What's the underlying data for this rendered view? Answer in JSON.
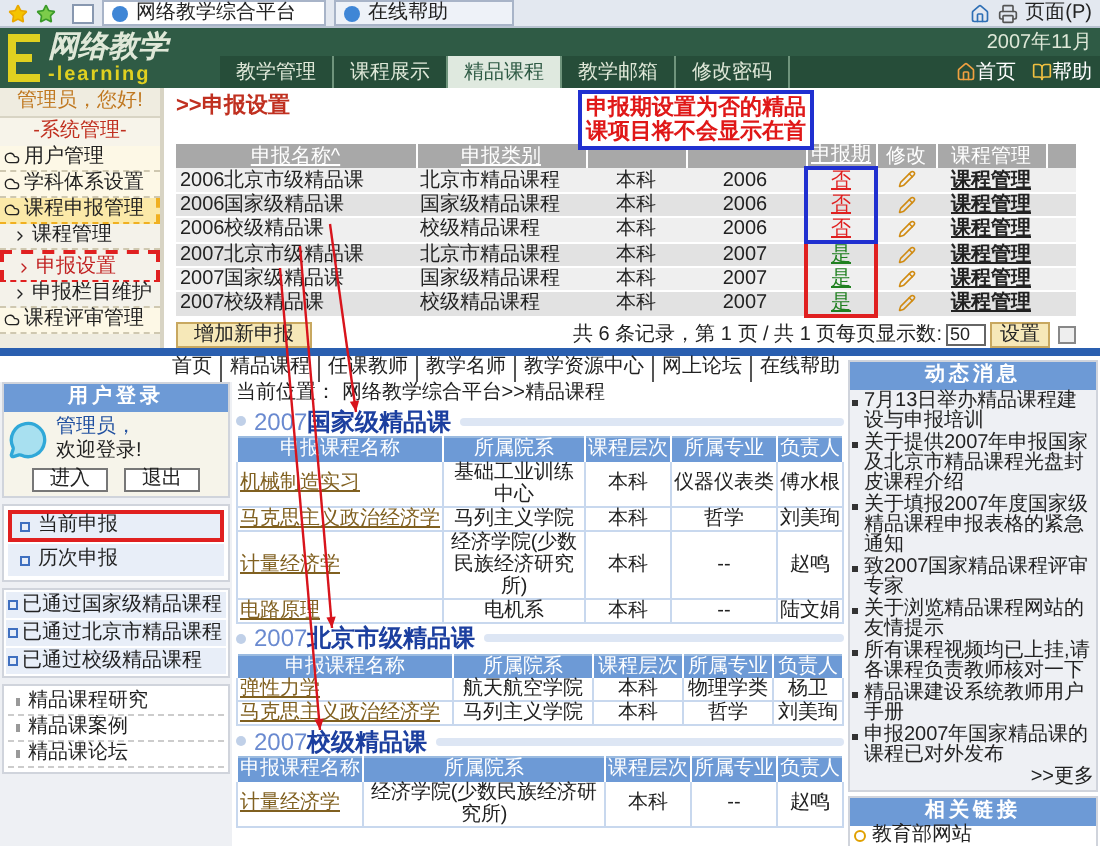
{
  "browser": {
    "tabs": [
      {
        "label": "网络教学综合平台",
        "selected": true
      },
      {
        "label": "在线帮助",
        "selected": false
      }
    ],
    "page_menu": "页面(P)"
  },
  "header": {
    "logo_title": "网络教学",
    "logo_subtitle": "-learning",
    "date": "2007年11月",
    "nav": [
      {
        "label": "教学管理",
        "selected": false
      },
      {
        "label": "课程展示",
        "selected": false
      },
      {
        "label": "精品课程",
        "selected": true
      },
      {
        "label": "教学邮箱",
        "selected": false
      },
      {
        "label": "修改密码",
        "selected": false
      }
    ],
    "links": [
      "首页",
      "帮助"
    ]
  },
  "admin_panel": {
    "greeting": "管理员，您好!",
    "section_title": "-系统管理-",
    "items": [
      {
        "label": "用户管理",
        "kind": "group",
        "expanded": false,
        "selected": false
      },
      {
        "label": "学科体系设置",
        "kind": "group",
        "expanded": false,
        "selected": false
      },
      {
        "label": "课程申报管理",
        "kind": "group",
        "expanded": true,
        "selected": false
      },
      {
        "label": "课程管理",
        "kind": "sub",
        "expanded": false,
        "selected": false
      },
      {
        "label": "申报设置",
        "kind": "sub",
        "expanded": false,
        "selected": true
      },
      {
        "label": "申报栏目维护",
        "kind": "sub",
        "expanded": false,
        "selected": false
      },
      {
        "label": "课程评审管理",
        "kind": "group",
        "expanded": false,
        "selected": false
      }
    ]
  },
  "apply_settings": {
    "title": ">>申报设置",
    "columns": [
      "申报名称^",
      "申报类别",
      "申报期",
      "修改",
      "课程管理"
    ],
    "rows": [
      {
        "name": "2006北京市级精品课",
        "category": "北京市精品课程",
        "level": "本科",
        "year": "2006",
        "open": false,
        "period": "否",
        "manage": "课程管理"
      },
      {
        "name": "2006国家级精品课",
        "category": "国家级精品课程",
        "level": "本科",
        "year": "2006",
        "open": false,
        "period": "否",
        "manage": "课程管理"
      },
      {
        "name": "2006校级精品课",
        "category": "校级精品课程",
        "level": "本科",
        "year": "2006",
        "open": false,
        "period": "否",
        "manage": "课程管理"
      },
      {
        "name": "2007北京市级精品课",
        "category": "北京市精品课程",
        "level": "本科",
        "year": "2007",
        "open": true,
        "period": "是",
        "manage": "课程管理"
      },
      {
        "name": "2007国家级精品课",
        "category": "国家级精品课程",
        "level": "本科",
        "year": "2007",
        "open": true,
        "period": "是",
        "manage": "课程管理"
      },
      {
        "name": "2007校级精品课",
        "category": "校级精品课程",
        "level": "本科",
        "year": "2007",
        "open": true,
        "period": "是",
        "manage": "课程管理"
      }
    ],
    "add_button": "增加新申报",
    "pager": {
      "summary": "共 6 条记录，第 1 页 / 共 1 页每页显示数:",
      "page_size": "50",
      "button": "设置"
    }
  },
  "callout": [
    "申报期设置为否的精品",
    "课项目将不会显示在首"
  ],
  "portal": {
    "nav": [
      "首页",
      "精品课程",
      "任课教师",
      "教学名师",
      "教学资源中心",
      "网上论坛",
      "在线帮助"
    ],
    "login": {
      "title": "用户登录",
      "user": "管理员，",
      "welcome": "欢迎登录!",
      "buttons": [
        "进入",
        "退出"
      ]
    },
    "declare_menu": [
      {
        "label": "当前申报",
        "selected": true
      },
      {
        "label": "历次申报",
        "selected": false
      }
    ],
    "approved_menu": [
      "已通过国家级精品课程",
      "已通过北京市精品课程",
      "已通过校级精品课程"
    ],
    "links_menu": [
      "精品课程研究",
      "精品课案例",
      "精品课论坛"
    ],
    "location": "当前位置： 网络教学综合平台>>精品课程",
    "sections": [
      {
        "title": "2007**国家级精品课**",
        "columns": [
          "申报课程名称",
          "所属院系",
          "课程层次",
          "所属专业",
          "负责人"
        ],
        "rows": [
          [
            "机械制造实习",
            "基础工业训练中心",
            "本科",
            "仪器仪表类",
            "傅水根"
          ],
          [
            "马克思主义政治经济学",
            "马列主义学院",
            "本科",
            "哲学",
            "刘美珣"
          ],
          [
            "计量经济学",
            "经济学院(少数民族经济研究所)",
            "本科",
            "--",
            "赵鸣"
          ],
          [
            "电路原理",
            "电机系",
            "本科",
            "--",
            "陆文娟"
          ]
        ]
      },
      {
        "title": "2007**北京市级精品课**",
        "columns": [
          "申报课程名称",
          "所属院系",
          "课程层次",
          "所属专业",
          "负责人"
        ],
        "rows": [
          [
            "弹性力学",
            "航天航空学院",
            "本科",
            "物理学类",
            "杨卫"
          ],
          [
            "马克思主义政治经济学",
            "马列主义学院",
            "本科",
            "哲学",
            "刘美珣"
          ]
        ]
      },
      {
        "title": "2007**校级精品课**",
        "columns": [
          "申报课程名称",
          "所属院系",
          "课程层次",
          "所属专业",
          "负责人"
        ],
        "rows": [
          [
            "计量经济学",
            "经济学院(少数民族经济研究所)",
            "本科",
            "--",
            "赵鸣"
          ]
        ]
      }
    ],
    "news": {
      "title": "动态消息",
      "items": [
        "7月13日举办精品课程建设与申报培训",
        "关于提供2007年申报国家及北京市精品课程光盘封皮课程介绍",
        "关于填报2007年度国家级精品课程申报表格的紧急通知",
        "致2007国家精品课程评审专家",
        "关于浏览精品课程网站的友情提示",
        "所有课程视频均已上挂,请各课程负责教师核对一下",
        "精品课建设系统教师用户手册",
        "申报2007年国家精品课的课程已对外发布"
      ],
      "more": ">>更多"
    },
    "related": {
      "title": "相关链接",
      "items": [
        "教育部网站"
      ]
    }
  }
}
